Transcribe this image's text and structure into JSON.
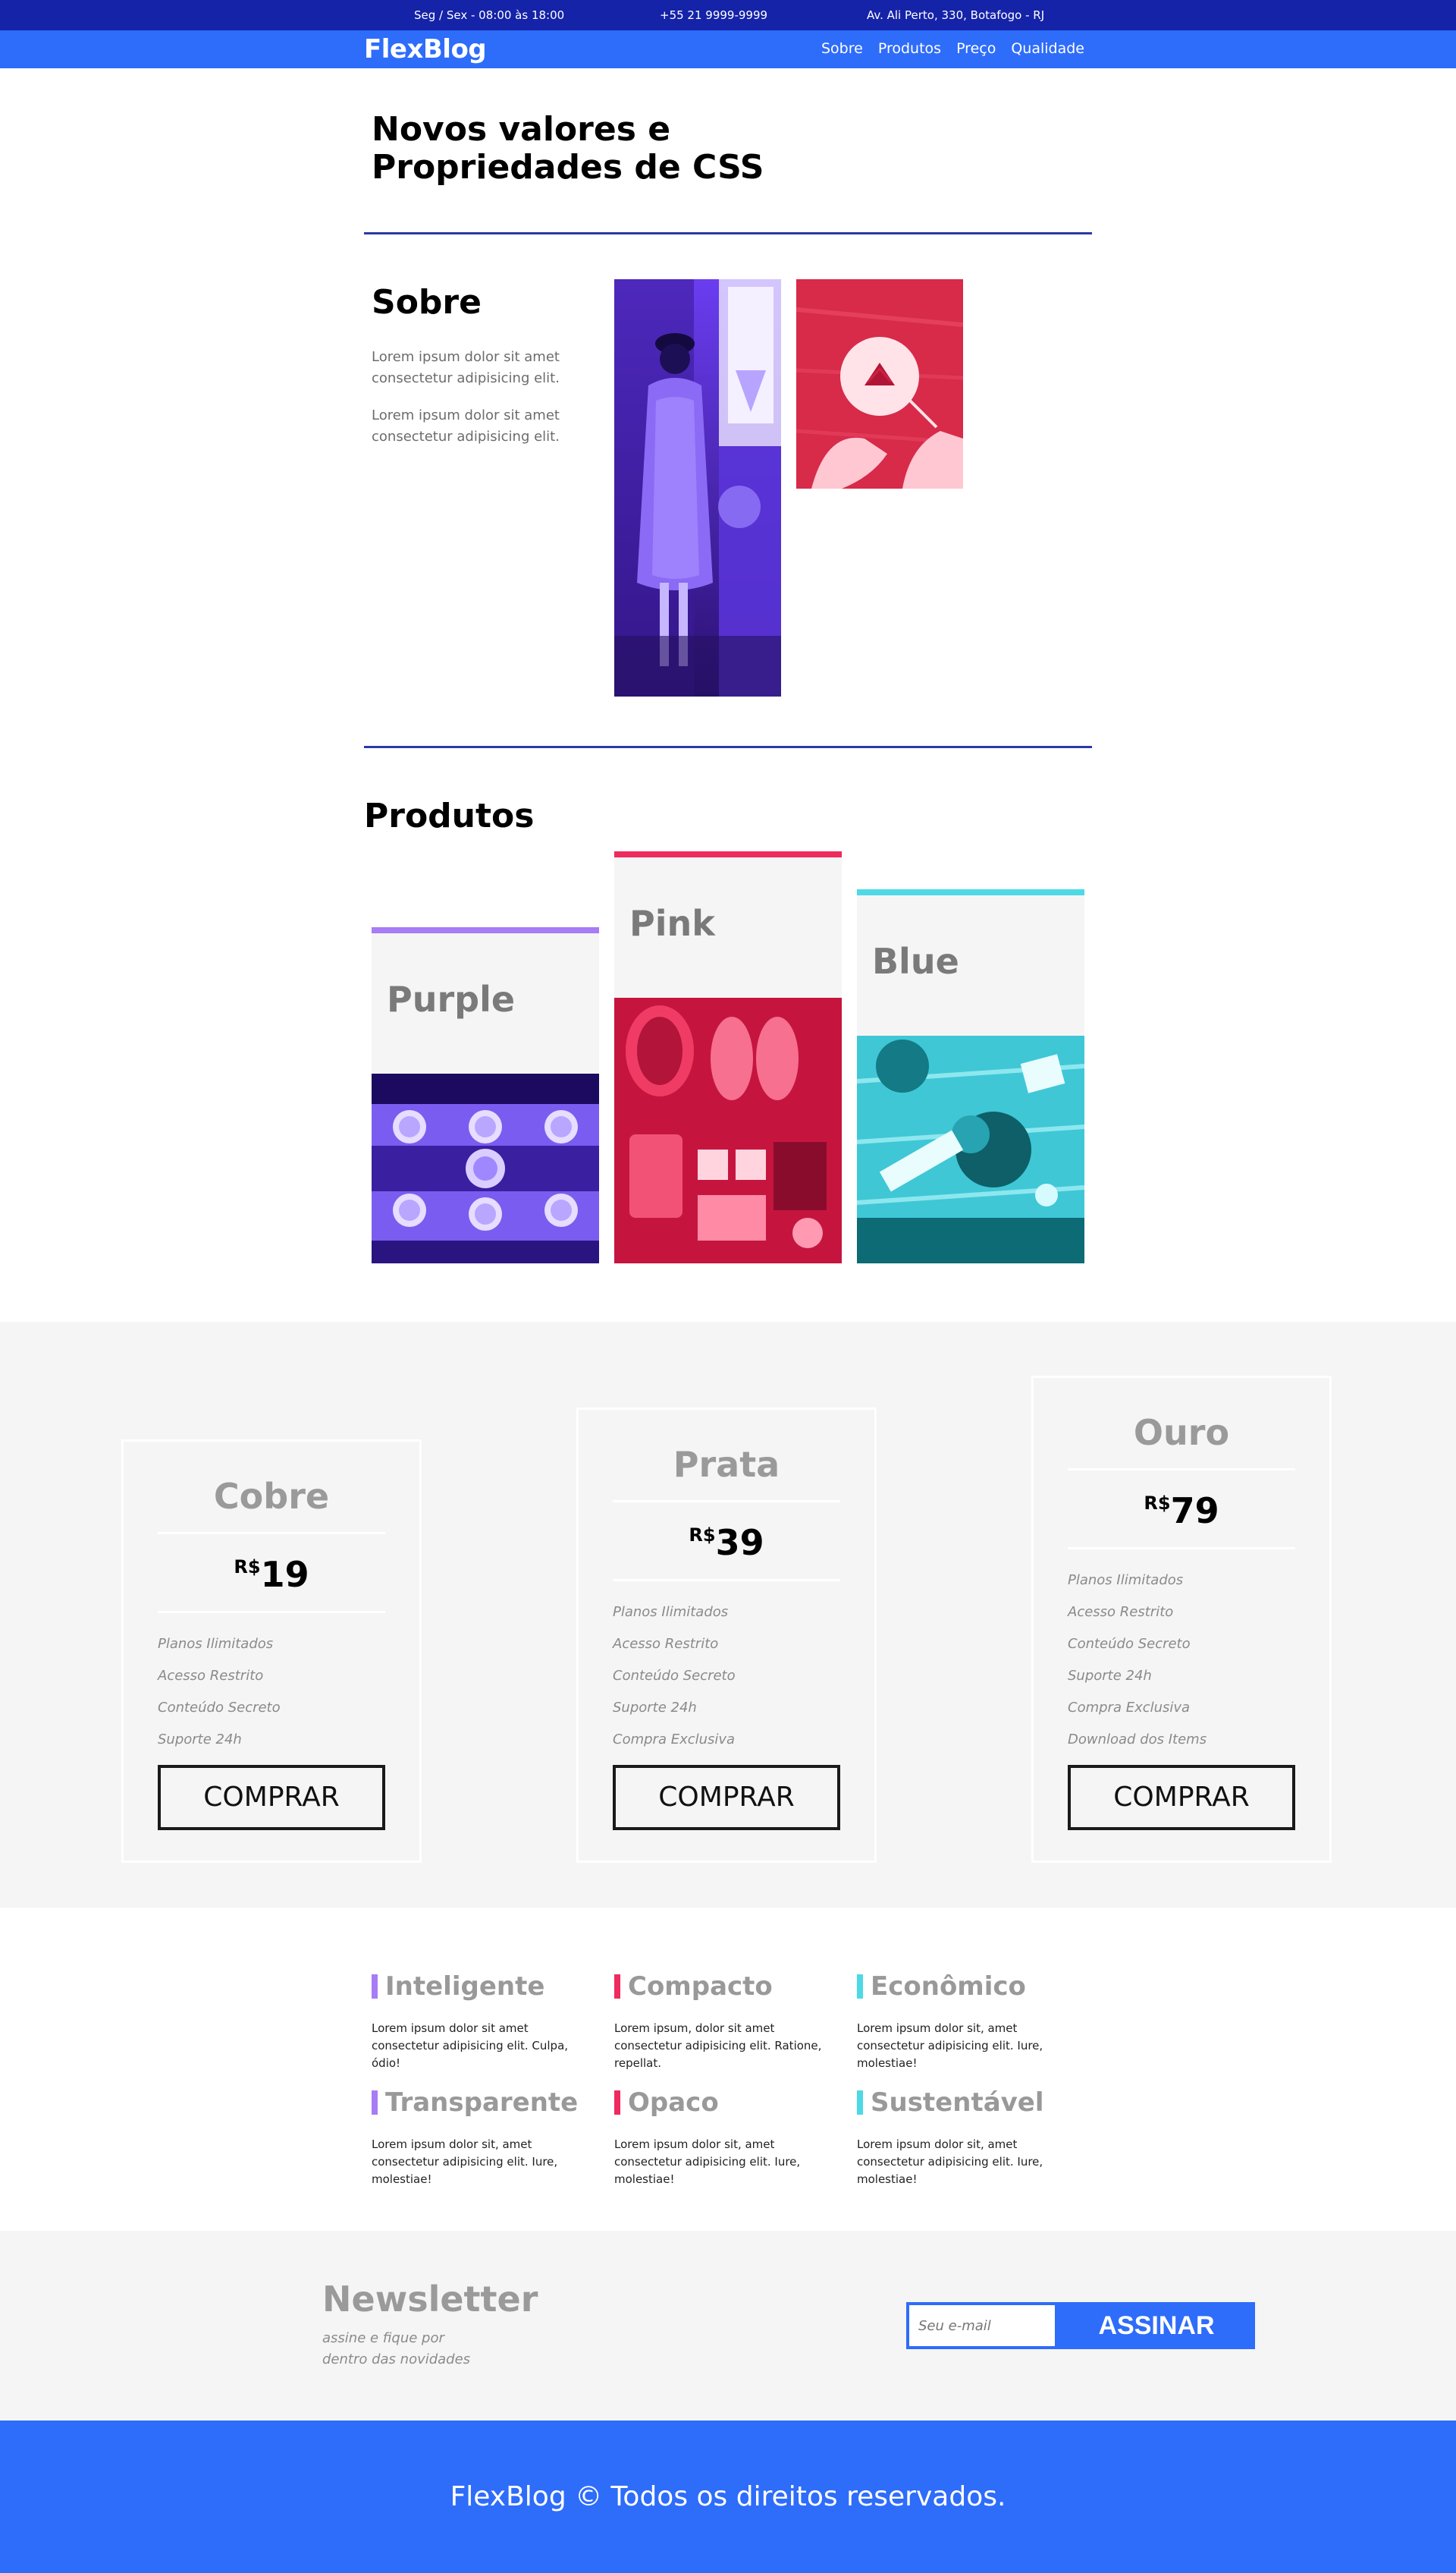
{
  "topbar": {
    "hours": "Seg / Sex - 08:00 às 18:00",
    "phone": "+55 21 9999-9999",
    "address": "Av. Ali Perto, 330, Botafogo - RJ"
  },
  "header": {
    "logo": "FlexBlog",
    "nav": [
      "Sobre",
      "Produtos",
      "Preço",
      "Qualidade"
    ]
  },
  "hero": {
    "title": "Novos valores e Propriedades de CSS"
  },
  "about": {
    "title": "Sobre",
    "paragraphs": [
      "Lorem ipsum dolor sit amet consectetur adipisicing elit.",
      "Lorem ipsum dolor sit amet consectetur adipisicing elit."
    ]
  },
  "products": {
    "title": "Produtos",
    "items": [
      {
        "name": "Purple",
        "color": "#a77cf4"
      },
      {
        "name": "Pink",
        "color": "#ee2a5e"
      },
      {
        "name": "Blue",
        "color": "#4dd9e6"
      }
    ]
  },
  "pricing": {
    "currency": "R$",
    "buy_label": "COMPRAR",
    "plans": [
      {
        "name": "Cobre",
        "price": "19",
        "features": [
          "Planos Ilimitados",
          "Acesso Restrito",
          "Conteúdo Secreto",
          "Suporte 24h"
        ]
      },
      {
        "name": "Prata",
        "price": "39",
        "features": [
          "Planos Ilimitados",
          "Acesso Restrito",
          "Conteúdo Secreto",
          "Suporte 24h",
          "Compra Exclusiva"
        ]
      },
      {
        "name": "Ouro",
        "price": "79",
        "features": [
          "Planos Ilimitados",
          "Acesso Restrito",
          "Conteúdo Secreto",
          "Suporte 24h",
          "Compra Exclusiva",
          "Download dos Items"
        ]
      }
    ]
  },
  "features": [
    {
      "title": "Inteligente",
      "text": "Lorem ipsum dolor sit amet consectetur adipisicing elit. Culpa, ódio!",
      "color": "#a77cf4"
    },
    {
      "title": "Compacto",
      "text": "Lorem ipsum, dolor sit amet consectetur adipisicing elit. Ratione, repellat.",
      "color": "#ee2a5e"
    },
    {
      "title": "Econômico",
      "text": "Lorem ipsum dolor sit, amet consectetur adipisicing elit. Iure, molestiae!",
      "color": "#4dd9e6"
    },
    {
      "title": "Transparente",
      "text": "Lorem ipsum dolor sit, amet consectetur adipisicing elit. Iure, molestiae!",
      "color": "#a77cf4"
    },
    {
      "title": "Opaco",
      "text": "Lorem ipsum dolor sit, amet consectetur adipisicing elit. Iure, molestiae!",
      "color": "#ee2a5e"
    },
    {
      "title": "Sustentável",
      "text": "Lorem ipsum dolor sit, amet consectetur adipisicing elit. Iure, molestiae!",
      "color": "#4dd9e6"
    }
  ],
  "newsletter": {
    "title": "Newsletter",
    "subtitle": "assine e fique por dentro das novidades",
    "placeholder": "Seu e-mail",
    "button": "ASSINAR"
  },
  "footer": {
    "text": "FlexBlog © Todos os direitos reservados."
  }
}
